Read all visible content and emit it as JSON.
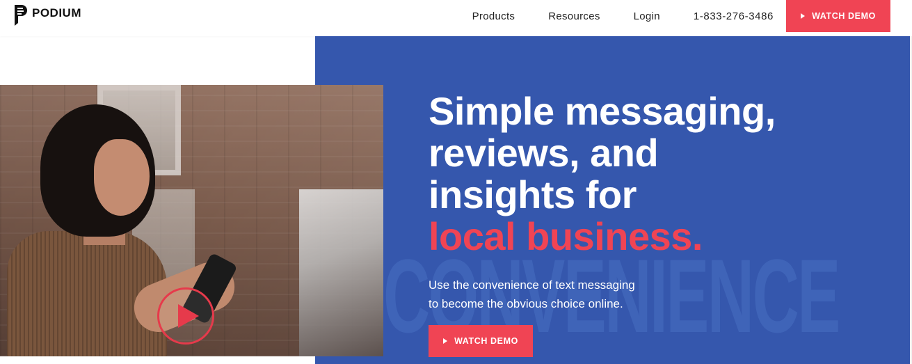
{
  "brand": {
    "name": "PODIUM",
    "logo_icon": "podium-logo-icon"
  },
  "nav": {
    "items": [
      {
        "label": "Products"
      },
      {
        "label": "Resources"
      },
      {
        "label": "Login"
      }
    ],
    "phone": "1-833-276-3486",
    "cta_label": "WATCH DEMO",
    "cta_icon": "play-icon"
  },
  "hero": {
    "headline_lines": [
      "Simple messaging,",
      "reviews, and",
      "insights for"
    ],
    "headline_accent": "local business.",
    "subtext_line1": "Use the convenience of text messaging",
    "subtext_line2": "to become the obvious choice online.",
    "cta_label": "WATCH DEMO",
    "cta_icon": "play-icon",
    "watermark": "CONVENIENCE",
    "video_icon": "play-circle-icon"
  },
  "colors": {
    "accent": "#f04454",
    "hero_blue": "#3557ad",
    "text_dark": "#222222"
  }
}
